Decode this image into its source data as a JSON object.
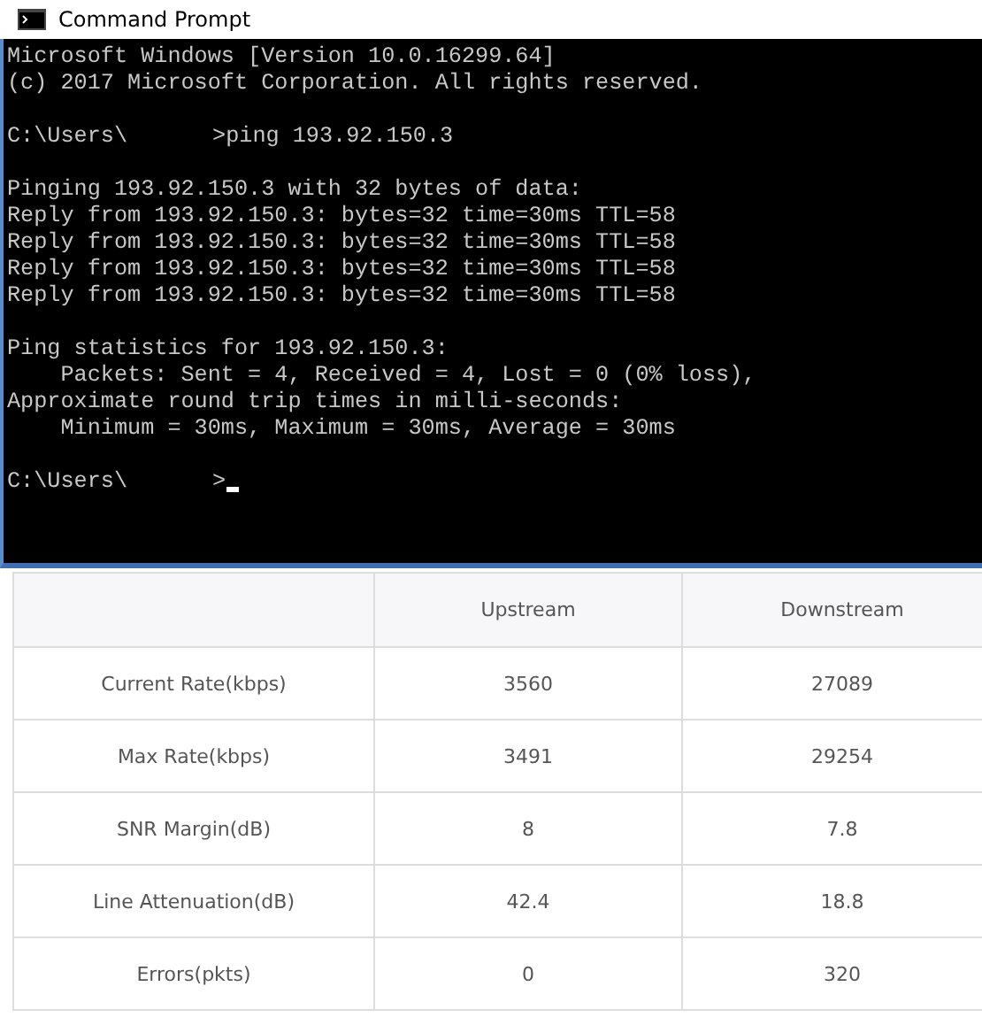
{
  "window": {
    "title": "Command Prompt"
  },
  "console": {
    "lines": [
      {
        "kind": "output",
        "text": "Microsoft Windows [Version 10.0.16299.64]"
      },
      {
        "kind": "output",
        "text": "(c) 2017 Microsoft Corporation. All rights reserved."
      },
      {
        "kind": "blank"
      },
      {
        "kind": "prompt",
        "path": "C:\\Users\\",
        "command": ">ping 193.92.150.3"
      },
      {
        "kind": "blank"
      },
      {
        "kind": "output",
        "text": "Pinging 193.92.150.3 with 32 bytes of data:"
      },
      {
        "kind": "output",
        "text": "Reply from 193.92.150.3: bytes=32 time=30ms TTL=58"
      },
      {
        "kind": "output",
        "text": "Reply from 193.92.150.3: bytes=32 time=30ms TTL=58"
      },
      {
        "kind": "output",
        "text": "Reply from 193.92.150.3: bytes=32 time=30ms TTL=58"
      },
      {
        "kind": "output",
        "text": "Reply from 193.92.150.3: bytes=32 time=30ms TTL=58"
      },
      {
        "kind": "blank"
      },
      {
        "kind": "output",
        "text": "Ping statistics for 193.92.150.3:"
      },
      {
        "kind": "output",
        "text": "    Packets: Sent = 4, Received = 4, Lost = 0 (0% loss),"
      },
      {
        "kind": "output",
        "text": "Approximate round trip times in milli-seconds:"
      },
      {
        "kind": "output",
        "text": "    Minimum = 30ms, Maximum = 30ms, Average = 30ms"
      },
      {
        "kind": "blank"
      },
      {
        "kind": "prompt",
        "path": "C:\\Users\\",
        "command": ">",
        "cursor": true
      }
    ]
  },
  "table": {
    "columns": [
      "Upstream",
      "Downstream"
    ],
    "rows": [
      {
        "label": "Current Rate(kbps)",
        "values": [
          "3560",
          "27089"
        ]
      },
      {
        "label": "Max Rate(kbps)",
        "values": [
          "3491",
          "29254"
        ]
      },
      {
        "label": "SNR Margin(dB)",
        "values": [
          "8",
          "7.8"
        ]
      },
      {
        "label": "Line Attenuation(dB)",
        "values": [
          "42.4",
          "18.8"
        ]
      },
      {
        "label": "Errors(pkts)",
        "values": [
          "0",
          "320"
        ]
      }
    ]
  }
}
